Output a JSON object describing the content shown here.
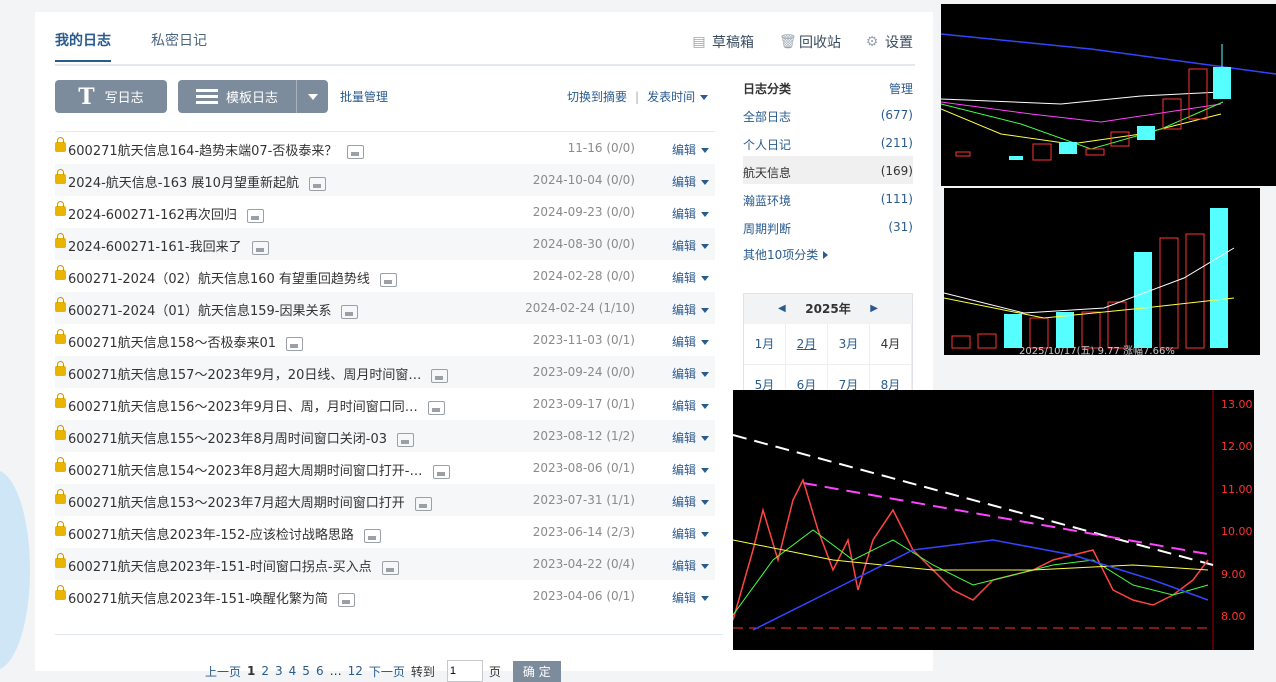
{
  "tabs": [
    "我的日志",
    "私密日记"
  ],
  "tools": {
    "draft": "草稿箱",
    "recycle": "回收站",
    "settings": "设置"
  },
  "toolbar": {
    "write": "写日志",
    "template": "模板日志",
    "batch": "批量管理",
    "switch": "切换到摘要",
    "sort": "发表时间",
    "edit": "编辑"
  },
  "posts": [
    {
      "title": "600271航天信息164-趋势末端07-否极泰来？",
      "date": "11-16",
      "stats": "(0/0)"
    },
    {
      "title": "2024-航天信息-163 展10月望重新起航",
      "date": "2024-10-04",
      "stats": "(0/0)"
    },
    {
      "title": "2024-600271-162再次回归",
      "date": "2024-09-23",
      "stats": "(0/0)"
    },
    {
      "title": "2024-600271-161-我回来了",
      "date": "2024-08-30",
      "stats": "(0/0)"
    },
    {
      "title": "600271-2024（02）航天信息160 有望重回趋势线",
      "date": "2024-02-28",
      "stats": "(0/0)"
    },
    {
      "title": "600271-2024（01）航天信息159-因果关系",
      "date": "2024-02-24",
      "stats": "(1/10)"
    },
    {
      "title": "600271航天信息158～否极泰来01",
      "date": "2023-11-03",
      "stats": "(0/1)"
    },
    {
      "title": "600271航天信息157～2023年9月，20日线、周月时间窗…",
      "date": "2023-09-24",
      "stats": "(0/0)"
    },
    {
      "title": "600271航天信息156～2023年9月日、周，月时间窗口同…",
      "date": "2023-09-17",
      "stats": "(0/1)"
    },
    {
      "title": "600271航天信息155～2023年8月周时间窗口关闭-03",
      "date": "2023-08-12",
      "stats": "(1/2)"
    },
    {
      "title": "600271航天信息154～2023年8月超大周期时间窗口打开-…",
      "date": "2023-08-06",
      "stats": "(0/1)"
    },
    {
      "title": "600271航天信息153～2023年7月超大周期时间窗口打开",
      "date": "2023-07-31",
      "stats": "(1/1)"
    },
    {
      "title": "600271航天信息2023年-152-应该检讨战略思路",
      "date": "2023-06-14",
      "stats": "(2/3)"
    },
    {
      "title": "600271航天信息2023年-151-时间窗口拐点-买入点",
      "date": "2023-04-22",
      "stats": "(0/4)"
    },
    {
      "title": "600271航天信息2023年-151-唤醒化繁为简",
      "date": "2023-04-06",
      "stats": "(0/1)"
    }
  ],
  "pager": {
    "prev": "上一页",
    "pages": [
      "1",
      "2",
      "3",
      "4",
      "5",
      "6",
      "…",
      "12"
    ],
    "next": "下一页",
    "goto": "转到",
    "page_unit": "页",
    "page_value": "1",
    "ok": "确 定"
  },
  "sidebar": {
    "title": "日志分类",
    "manage": "管理",
    "categories": [
      {
        "name": "全部日志",
        "count": "(677)"
      },
      {
        "name": "个人日记",
        "count": "(211)"
      },
      {
        "name": "航天信息",
        "count": "(169)"
      },
      {
        "name": "瀚蓝环境",
        "count": "(111)"
      },
      {
        "name": "周期判断",
        "count": "(31)"
      }
    ],
    "more": "其他10项分类"
  },
  "calendar": {
    "year": "2025年",
    "months": [
      "1月",
      "2月",
      "3月",
      "4月",
      "5月",
      "6月",
      "7月",
      "8月"
    ]
  },
  "chart_overlay": {
    "caption": "2025/10/17(五) 9.77 涨幅7.66%",
    "price_axis": [
      "13.00",
      "12.00",
      "11.00",
      "10.00",
      "9.00",
      "8.00"
    ]
  }
}
